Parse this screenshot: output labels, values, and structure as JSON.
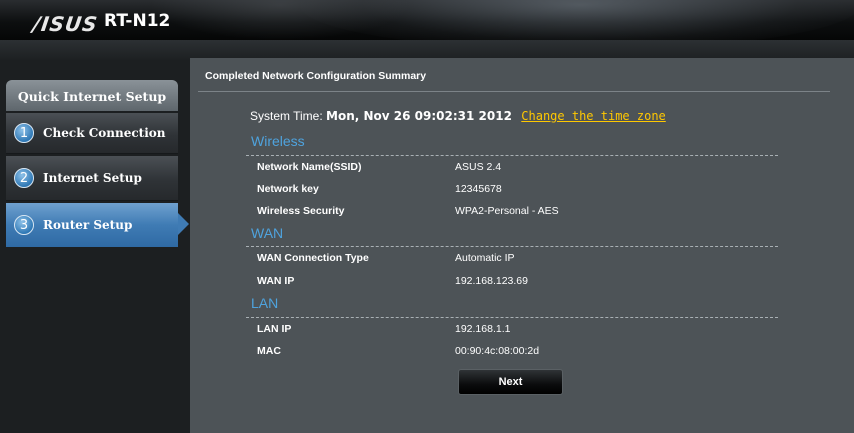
{
  "header": {
    "brand_logo": "/ISUS",
    "model": "RT-N12"
  },
  "sidebar": {
    "title": "Quick Internet Setup",
    "steps": [
      {
        "num": "1",
        "label": "Check Connection"
      },
      {
        "num": "2",
        "label": "Internet Setup"
      },
      {
        "num": "3",
        "label": "Router Setup"
      }
    ],
    "active_step": 3
  },
  "panel": {
    "title": "Completed Network Configuration Summary",
    "system_time_label": "System Time:",
    "system_time_value": "Mon, Nov 26 09:02:31 2012",
    "change_timezone_link": "Change the time zone"
  },
  "wireless": {
    "heading": "Wireless",
    "ssid_label": "Network Name(SSID)",
    "ssid_value": "ASUS 2.4",
    "key_label": "Network key",
    "key_value": "12345678",
    "security_label": "Wireless Security",
    "security_value": "WPA2-Personal - AES"
  },
  "wan": {
    "heading": "WAN",
    "type_label": "WAN Connection Type",
    "type_value": "Automatic IP",
    "ip_label": "WAN IP",
    "ip_value": "192.168.123.69"
  },
  "lan": {
    "heading": "LAN",
    "ip_label": "LAN IP",
    "ip_value": "192.168.1.1",
    "mac_label": "MAC",
    "mac_value": "00:90:4c:08:00:2d"
  },
  "actions": {
    "next_label": "Next"
  },
  "colors": {
    "accent_blue": "#4ea3de",
    "link_yellow": "#ffc800",
    "panel_bg": "#4d5357",
    "active_step_bg": "#3f7bb4"
  }
}
